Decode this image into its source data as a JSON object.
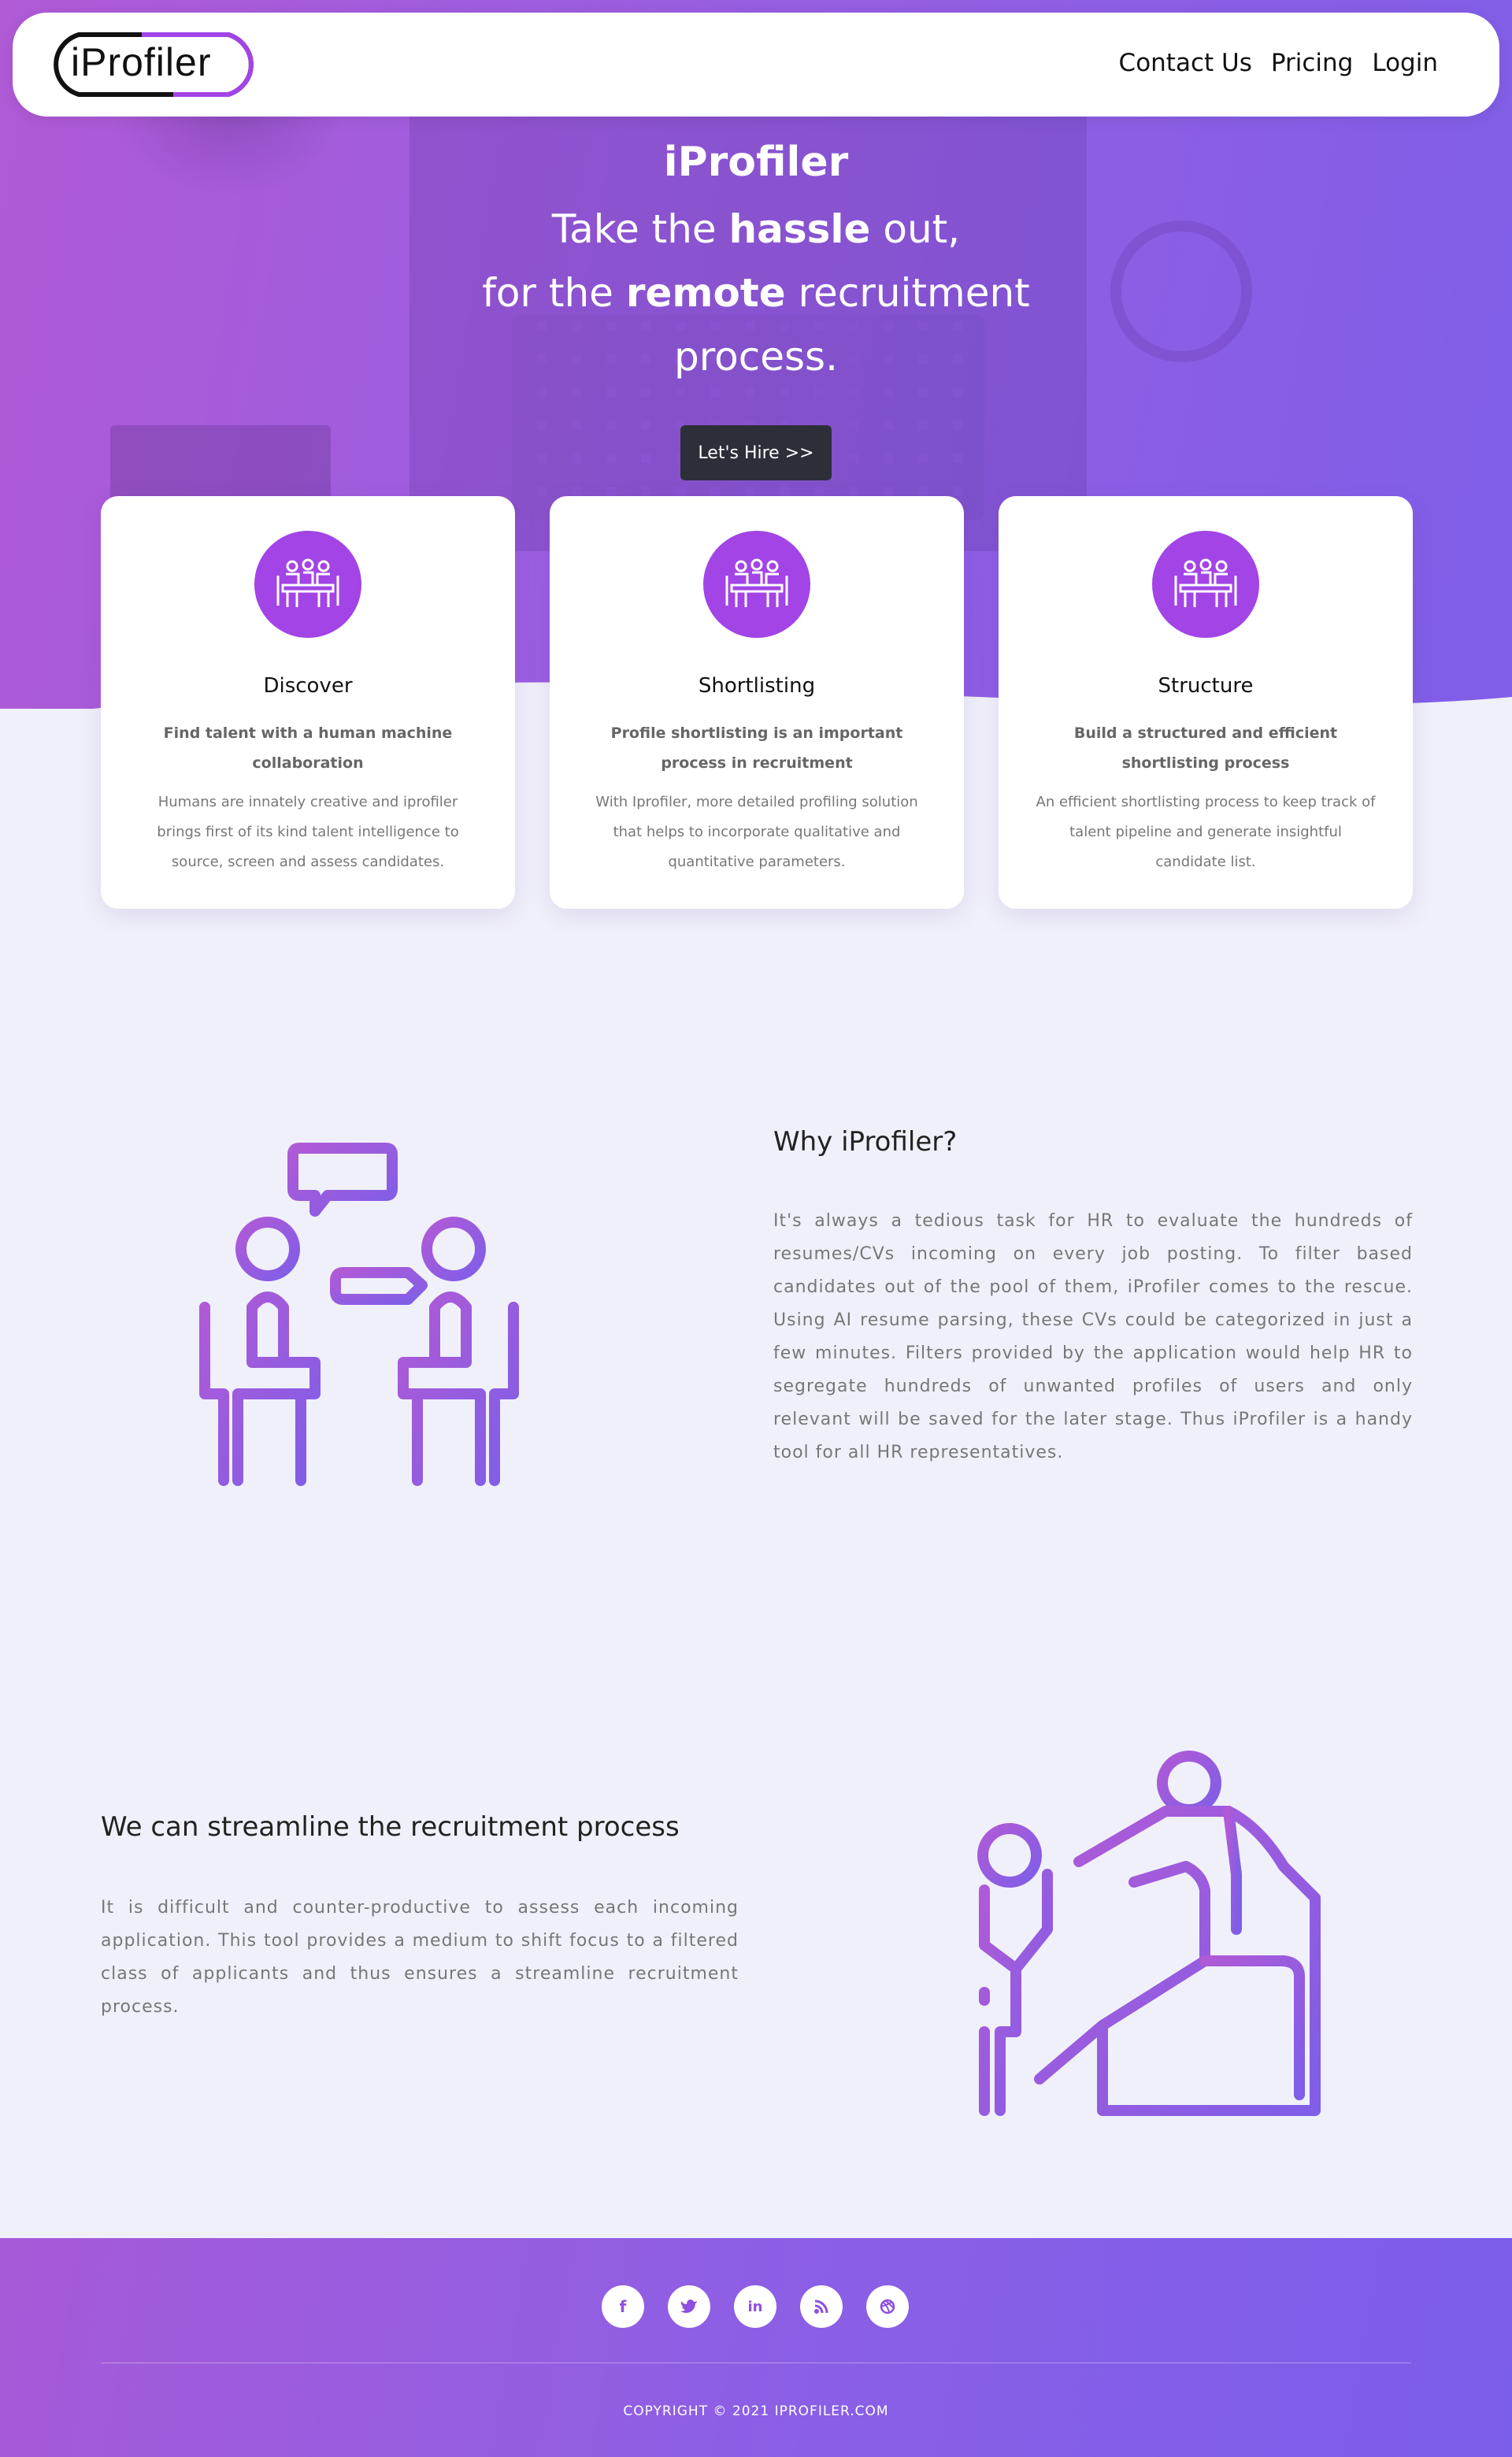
{
  "nav": {
    "logo_text": "iProfiler",
    "links": [
      "Contact Us",
      "Pricing",
      "Login"
    ]
  },
  "hero": {
    "title": "iProfiler",
    "line1_pre": "Take the ",
    "line1_bold": "hassle",
    "line1_post": " out,",
    "line2_pre": "for the ",
    "line2_bold": "remote",
    "line2_post": " recruitment",
    "line3": "process.",
    "button": "Let's Hire >>"
  },
  "cards": [
    {
      "title": "Discover",
      "subtitle": "Find talent with a human machine collaboration",
      "description": "Humans are innately creative and iprofiler brings first of its kind talent intelligence to source, screen and assess candidates."
    },
    {
      "title": "Shortlisting",
      "subtitle": "Profile shortlisting is an important process in recruitment",
      "description": "With Iprofiler, more detailed profiling solution that helps to incorporate qualitative and quantitative parameters."
    },
    {
      "title": "Structure",
      "subtitle": "Build a structured and efficient shortlisting process",
      "description": "An efficient shortlisting process to keep track of talent pipeline and generate insightful candidate list."
    }
  ],
  "why": {
    "title": "Why iProfiler?",
    "text": "It's always a tedious task for HR to evaluate the hundreds of resumes/CVs incoming on every job posting. To filter based candidates out of the pool of them, iProfiler comes to the rescue. Using AI resume parsing, these CVs could be categorized in just a few minutes. Filters provided by the application would help HR to segregate hundreds of unwanted profiles of users and only relevant will be saved for the later stage. Thus iProfiler is a handy tool for all HR representatives."
  },
  "streamline": {
    "title": "We can streamline the recruitment process",
    "text": "It is difficult and counter-productive to assess each incoming application. This tool provides a medium to shift focus to a filtered class of applicants and thus ensures a streamline recruitment process."
  },
  "footer": {
    "social_icons": [
      "facebook-icon",
      "twitter-icon",
      "linkedin-icon",
      "rss-icon",
      "dribbble-icon"
    ],
    "copyright": "COPYRIGHT © 2021 IPROFILER.COM"
  },
  "colors": {
    "accent": "#a244e6",
    "gradient_start": "#b05ad6",
    "gradient_end": "#7f5ee8",
    "button_dark": "#2c2f38",
    "page_bg": "#f0f0fa"
  }
}
